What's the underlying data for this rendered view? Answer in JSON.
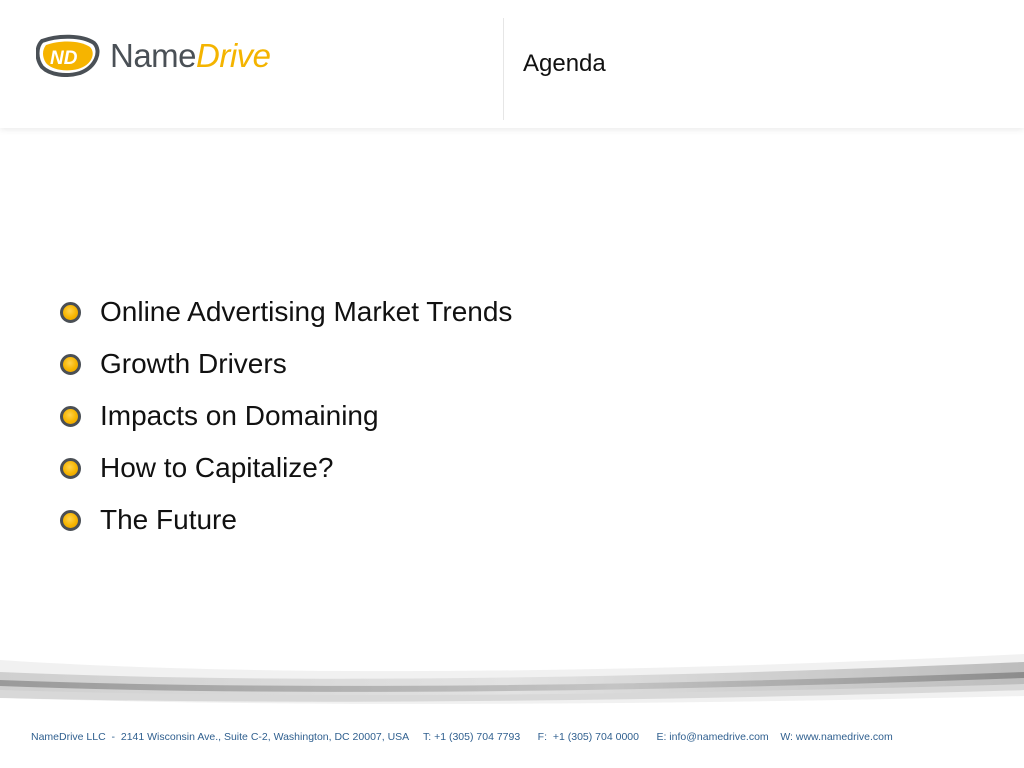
{
  "header": {
    "logo": {
      "name": "Name",
      "drive": "Drive",
      "mark_letters": "ND",
      "colors": {
        "name": "#4a5056",
        "drive": "#f4b400",
        "mark_fill": "#f6b400",
        "mark_outline": "#4a5056"
      }
    },
    "title": "Agenda"
  },
  "agenda": {
    "items": [
      {
        "label": "Online Advertising Market Trends"
      },
      {
        "label": "Growth Drivers"
      },
      {
        "label": "Impacts on Domaining"
      },
      {
        "label": "How to Capitalize?"
      },
      {
        "label": "The Future"
      }
    ],
    "bullet_icon": "circle-bullet-icon",
    "bullet_color": "#f6b400"
  },
  "footer": {
    "text": "NameDrive LLC  -  2141 Wisconsin Ave., Suite C-2, Washington, DC 20007, USA     T: +1 (305) 704 7793      F:  +1 (305) 704 0000      E: info@namedrive.com    W: www.namedrive.com",
    "color": "#2f5f8f"
  }
}
